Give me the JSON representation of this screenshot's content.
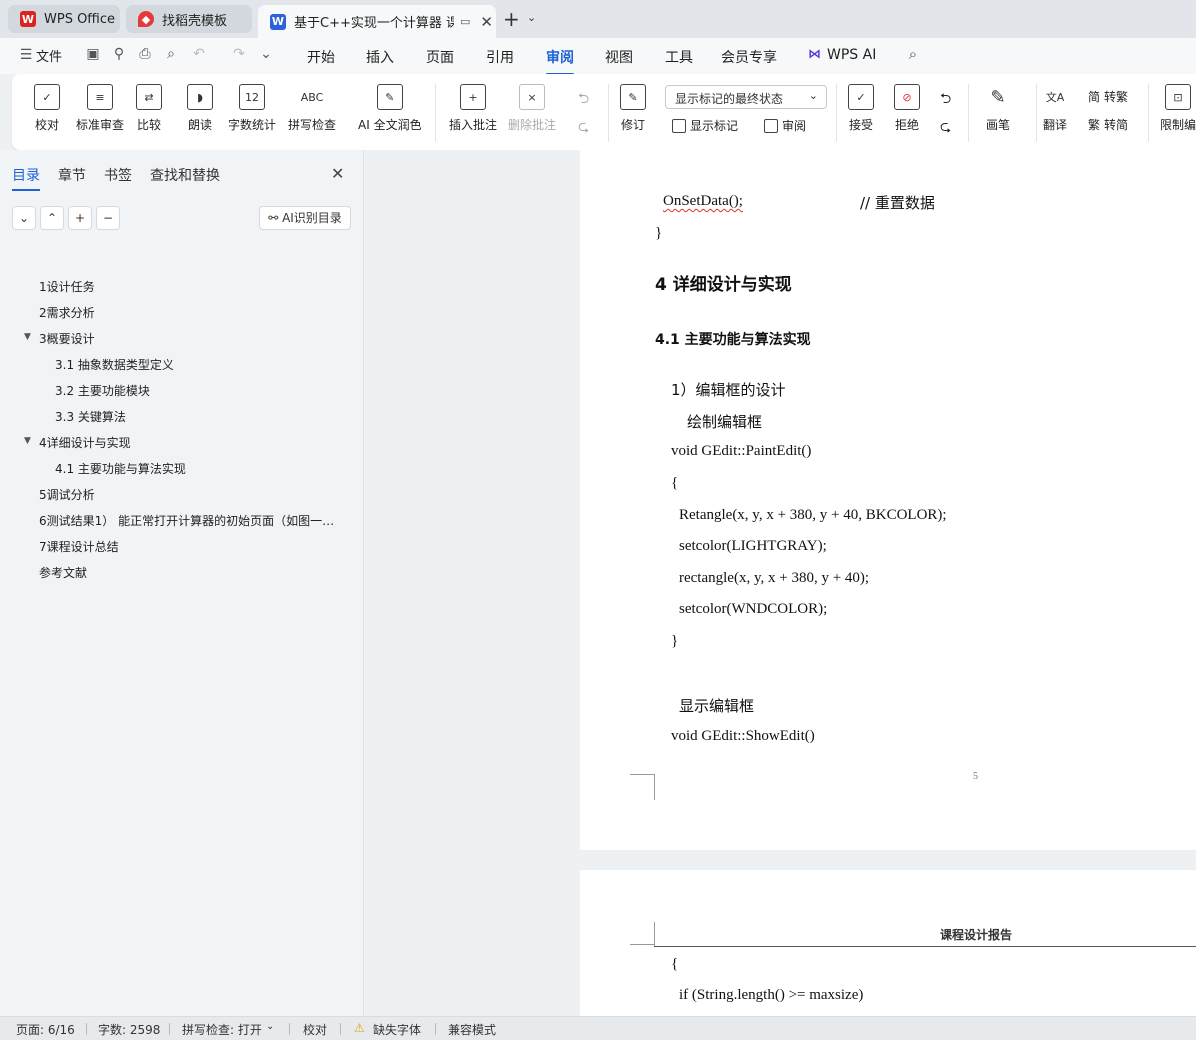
{
  "tabs": [
    {
      "label": "WPS Office",
      "color": "#d9251d"
    },
    {
      "label": "找稻壳模板",
      "color": "#e33b3b"
    },
    {
      "label": "基于C++实现一个计算器 课程",
      "color": "#2b62d9"
    }
  ],
  "new_tab": "+",
  "menu": {
    "file": "文件",
    "items": [
      "开始",
      "插入",
      "页面",
      "引用",
      "审阅",
      "视图",
      "工具",
      "会员专享"
    ],
    "active": "审阅",
    "wps_ai": "WPS AI"
  },
  "ribbon": {
    "proofread": "校对",
    "std_review": "标准审查",
    "compare": "比较",
    "read": "朗读",
    "word_count": "字数统计",
    "spell_check": "拼写检查",
    "ai_polish": "AI 全文润色",
    "insert_comment": "插入批注",
    "delete_comment": "删除批注",
    "revise": "修订",
    "display_select": "显示标记的最终状态",
    "show_marks": "显示标记",
    "review": "审阅",
    "accept": "接受",
    "reject": "拒绝",
    "pen": "画笔",
    "translate": "翻译",
    "to_trad": "转繁",
    "to_simp": "转简",
    "restrict": "限制编"
  },
  "nav": {
    "tabs": [
      "目录",
      "章节",
      "书签",
      "查找和替换"
    ],
    "active": "目录",
    "ai_toc": "AI识别目录",
    "toc": [
      {
        "text": "1设计任务",
        "level": 0
      },
      {
        "text": "2需求分析",
        "level": 0
      },
      {
        "text": "3概要设计",
        "level": 0,
        "expanded": true
      },
      {
        "text": "3.1 抽象数据类型定义",
        "level": 1
      },
      {
        "text": "3.2 主要功能模块",
        "level": 1
      },
      {
        "text": "3.3 关键算法",
        "level": 1
      },
      {
        "text": "4详细设计与实现",
        "level": 0,
        "expanded": true
      },
      {
        "text": "4.1 主要功能与算法实现",
        "level": 1
      },
      {
        "text": "5调试分析",
        "level": 0
      },
      {
        "text": "6测试结果1） 能正常打开计算器的初始页面（如图一…",
        "level": 0
      },
      {
        "text": "7课程设计总结",
        "level": 0
      },
      {
        "text": "参考文献",
        "level": 0
      }
    ]
  },
  "doc": {
    "l1a": "OnSetData();",
    "l1b": "//  重置数据",
    "l2": "}",
    "h4": "4   详细设计与实现",
    "h41": "4.1  主要功能与算法实现",
    "p1": "1）编辑框的设计",
    "p2": "绘制编辑框",
    "c1": "void GEdit::PaintEdit()",
    "c2": "{",
    "c3": "Retangle(x, y, x + 380, y + 40, BKCOLOR);",
    "c4": "setcolor(LIGHTGRAY);",
    "c5": "rectangle(x, y, x + 380, y + 40);",
    "c6": "setcolor(WNDCOLOR);",
    "c7": "}",
    "p3": "显示编辑框",
    "c8": "void GEdit::ShowEdit()",
    "page_no": "5",
    "header2": "课程设计报告",
    "c9": "{",
    "c10": "if (String.length() >= maxsize)"
  },
  "status": {
    "page": "页面: 6/16",
    "words": "字数: 2598",
    "spell": "拼写检查: 打开",
    "proof": "校对",
    "missing_font": "缺失字体",
    "compat": "兼容模式"
  }
}
